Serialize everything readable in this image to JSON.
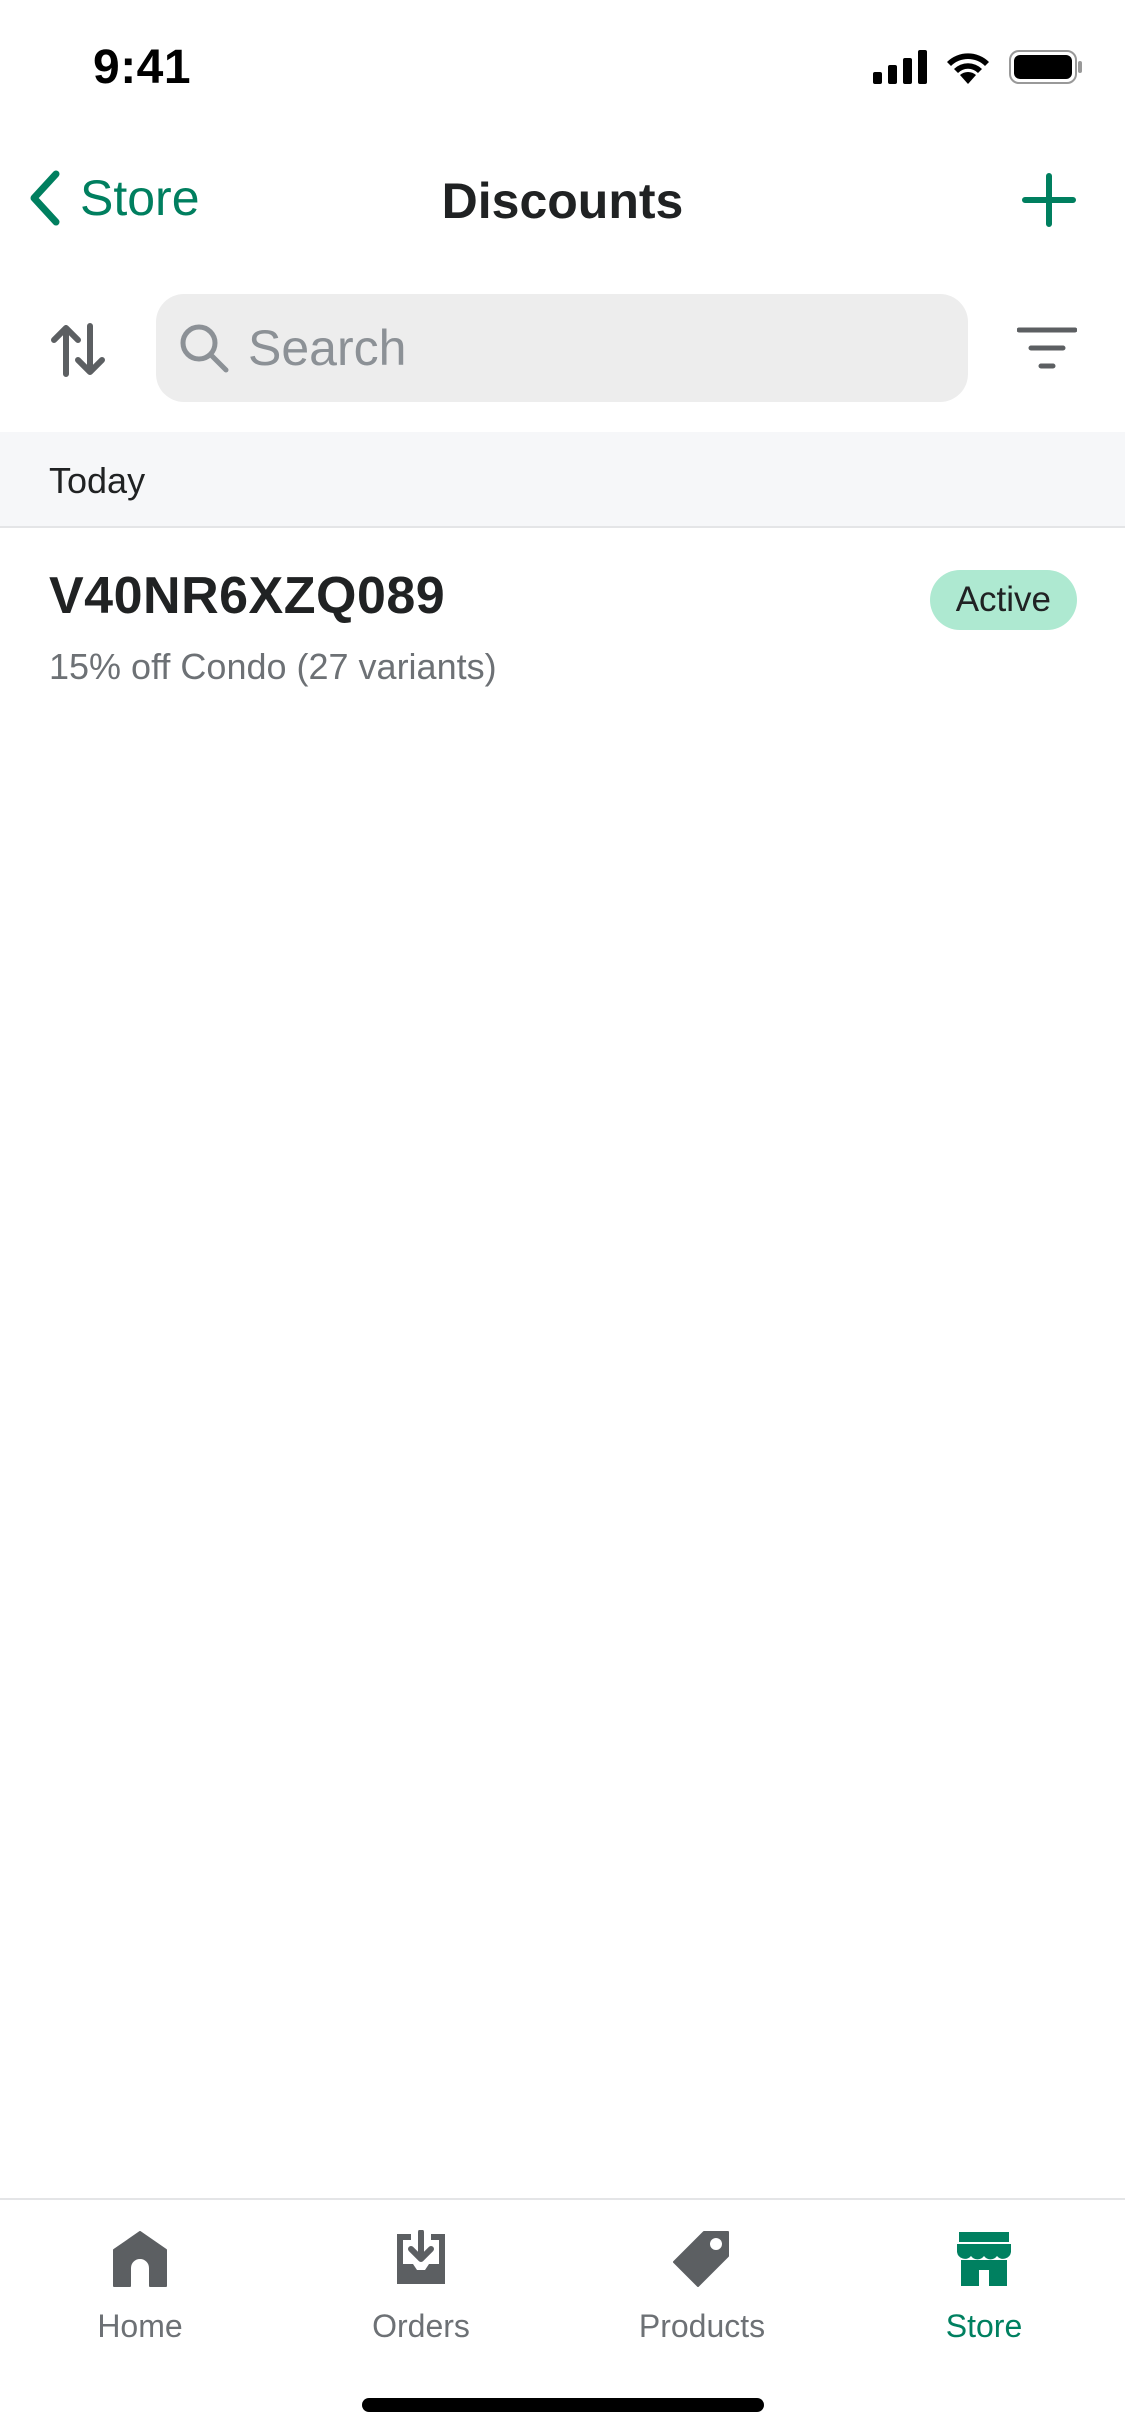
{
  "status_bar": {
    "time": "9:41"
  },
  "nav": {
    "back_label": "Store",
    "title": "Discounts"
  },
  "search": {
    "placeholder": "Search",
    "value": ""
  },
  "section": {
    "label": "Today"
  },
  "discounts": [
    {
      "code": "V40NR6XZQ089",
      "summary": "15% off Condo (27 variants)",
      "status": "Active"
    }
  ],
  "tabs": [
    {
      "label": "Home",
      "icon": "home-icon"
    },
    {
      "label": "Orders",
      "icon": "orders-icon"
    },
    {
      "label": "Products",
      "icon": "tag-icon"
    },
    {
      "label": "Store",
      "icon": "store-icon",
      "active": true
    }
  ],
  "colors": {
    "accent": "#007f5f",
    "active_tab": "#008060",
    "badge_bg": "#aee9d1",
    "search_bg": "#ededed",
    "icon_gray": "#5c5f62"
  }
}
